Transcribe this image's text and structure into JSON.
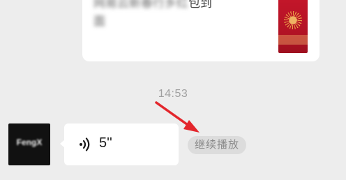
{
  "link_card": {
    "title_blurred": "网易云新春行乡红",
    "title_visible": "包到",
    "title_line2": "面"
  },
  "chat": {
    "timestamp": "14:53",
    "avatar_text": "FengX",
    "voice_message": {
      "duration": "5''"
    },
    "resume_label": "继续播放"
  },
  "icons": {
    "voice": "voice-wave-icon",
    "annotation": "red-arrow-icon"
  },
  "colors": {
    "background": "#ededed",
    "bubble": "#ffffff",
    "timestamp": "#a0a0a0",
    "resume_pill": "#dcdcdc",
    "arrow": "#e3262c"
  }
}
